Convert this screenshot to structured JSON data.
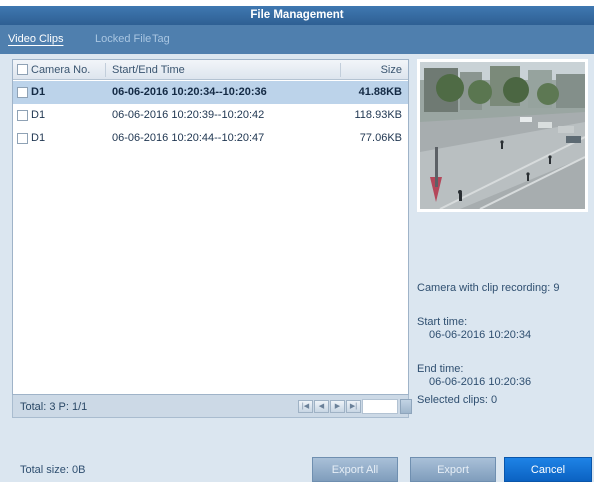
{
  "window": {
    "title": "File Management"
  },
  "tabs": [
    {
      "label": "Video Clips",
      "active": true
    },
    {
      "label": "Locked File",
      "active": false
    },
    {
      "label": "Tag",
      "active": false
    }
  ],
  "table": {
    "columns": [
      "Camera No.",
      "Start/End Time",
      "Size"
    ],
    "rows": [
      {
        "camera": "D1",
        "time": "06-06-2016 10:20:34--10:20:36",
        "size": "41.88KB",
        "selected": true
      },
      {
        "camera": "D1",
        "time": "06-06-2016 10:20:39--10:20:42",
        "size": "118.93KB",
        "selected": false
      },
      {
        "camera": "D1",
        "time": "06-06-2016 10:20:44--10:20:47",
        "size": "77.06KB",
        "selected": false
      }
    ]
  },
  "footer": {
    "totals": "Total: 3  P: 1/1",
    "total_size": "Total size: 0B"
  },
  "info": {
    "camera_clip_recording": "Camera with clip recording: 9",
    "start_label": "Start time:",
    "start_value": "06-06-2016 10:20:34",
    "end_label": "End time:",
    "end_value": "06-06-2016 10:20:36",
    "selected_clips": "Selected clips: 0"
  },
  "buttons": {
    "export_all": "Export All",
    "export": "Export",
    "cancel": "Cancel"
  },
  "colors": {
    "title_bar": "#2e5f93",
    "tab_bar": "#4f7fae",
    "selected_row": "#bcd3ea",
    "cancel_button": "#0b62c2"
  }
}
